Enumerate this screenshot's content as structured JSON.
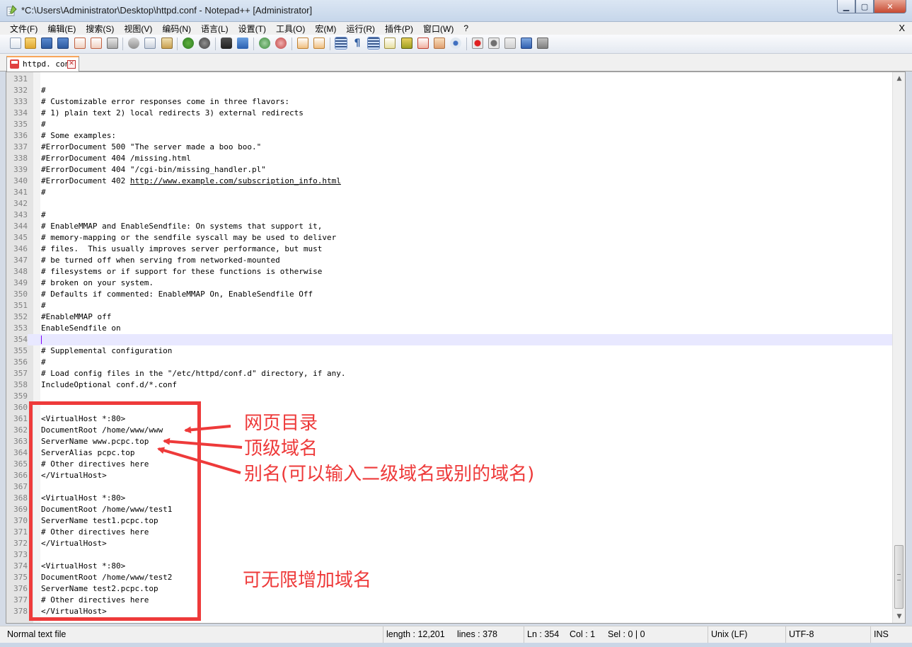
{
  "window": {
    "title": "*C:\\Users\\Administrator\\Desktop\\httpd.conf - Notepad++ [Administrator]",
    "minimize_label": "▁",
    "maximize_label": "▢",
    "close_label": "✕"
  },
  "menu": {
    "items": [
      "文件(F)",
      "编辑(E)",
      "搜索(S)",
      "视图(V)",
      "编码(N)",
      "语言(L)",
      "设置(T)",
      "工具(O)",
      "宏(M)",
      "运行(R)",
      "插件(P)",
      "窗口(W)",
      "?"
    ],
    "close_label": "X"
  },
  "toolbar": {
    "buttons": [
      "new-icon",
      "open-icon",
      "save-icon",
      "save-all-icon",
      "close-icon",
      "close-all-icon",
      "print-icon",
      "cut-icon",
      "copy-icon",
      "paste-icon",
      "undo-icon",
      "redo-icon",
      "find-icon",
      "replace-icon",
      "zoom-in-icon",
      "zoom-out-icon",
      "sync-vertical-icon",
      "sync-horizontal-icon",
      "word-wrap-icon",
      "show-all-chars-icon",
      "indent-guide-icon",
      "user-lang-icon",
      "doc-map-icon",
      "function-list-icon",
      "folder-workspace-icon",
      "monitor-icon",
      "record-macro-icon",
      "stop-macro-icon",
      "play-macro-icon",
      "run-macro-multiple-icon",
      "save-macro-icon"
    ]
  },
  "tab": {
    "label": "httpd. conf",
    "close_label": "✕"
  },
  "editor": {
    "current_line": 354,
    "lines": [
      {
        "n": "331",
        "t": ""
      },
      {
        "n": "332",
        "t": "#"
      },
      {
        "n": "333",
        "t": "# Customizable error responses come in three flavors:"
      },
      {
        "n": "334",
        "t": "# 1) plain text 2) local redirects 3) external redirects"
      },
      {
        "n": "335",
        "t": "#"
      },
      {
        "n": "336",
        "t": "# Some examples:"
      },
      {
        "n": "337",
        "t": "#ErrorDocument 500 \"The server made a boo boo.\""
      },
      {
        "n": "338",
        "t": "#ErrorDocument 404 /missing.html"
      },
      {
        "n": "339",
        "t": "#ErrorDocument 404 \"/cgi-bin/missing_handler.pl\""
      },
      {
        "n": "340",
        "t": "#ErrorDocument 402 ",
        "link": "http://www.example.com/subscription_info.html"
      },
      {
        "n": "341",
        "t": "#"
      },
      {
        "n": "342",
        "t": ""
      },
      {
        "n": "343",
        "t": "#"
      },
      {
        "n": "344",
        "t": "# EnableMMAP and EnableSendfile: On systems that support it,"
      },
      {
        "n": "345",
        "t": "# memory-mapping or the sendfile syscall may be used to deliver"
      },
      {
        "n": "346",
        "t": "# files.  This usually improves server performance, but must"
      },
      {
        "n": "347",
        "t": "# be turned off when serving from networked-mounted"
      },
      {
        "n": "348",
        "t": "# filesystems or if support for these functions is otherwise"
      },
      {
        "n": "349",
        "t": "# broken on your system."
      },
      {
        "n": "350",
        "t": "# Defaults if commented: EnableMMAP On, EnableSendfile Off"
      },
      {
        "n": "351",
        "t": "#"
      },
      {
        "n": "352",
        "t": "#EnableMMAP off"
      },
      {
        "n": "353",
        "t": "EnableSendfile on"
      },
      {
        "n": "354",
        "t": ""
      },
      {
        "n": "355",
        "t": "# Supplemental configuration"
      },
      {
        "n": "356",
        "t": "#"
      },
      {
        "n": "357",
        "t": "# Load config files in the \"/etc/httpd/conf.d\" directory, if any."
      },
      {
        "n": "358",
        "t": "IncludeOptional conf.d/*.conf"
      },
      {
        "n": "359",
        "t": ""
      },
      {
        "n": "360",
        "t": ""
      },
      {
        "n": "361",
        "t": "<VirtualHost *:80>"
      },
      {
        "n": "362",
        "t": "DocumentRoot /home/www/www"
      },
      {
        "n": "363",
        "t": "ServerName www.pcpc.top"
      },
      {
        "n": "364",
        "t": "ServerAlias pcpc.top"
      },
      {
        "n": "365",
        "t": "# Other directives here"
      },
      {
        "n": "366",
        "t": "</VirtualHost>"
      },
      {
        "n": "367",
        "t": ""
      },
      {
        "n": "368",
        "t": "<VirtualHost *:80>"
      },
      {
        "n": "369",
        "t": "DocumentRoot /home/www/test1"
      },
      {
        "n": "370",
        "t": "ServerName test1.pcpc.top"
      },
      {
        "n": "371",
        "t": "# Other directives here"
      },
      {
        "n": "372",
        "t": "</VirtualHost>"
      },
      {
        "n": "373",
        "t": ""
      },
      {
        "n": "374",
        "t": "<VirtualHost *:80>"
      },
      {
        "n": "375",
        "t": "DocumentRoot /home/www/test2"
      },
      {
        "n": "376",
        "t": "ServerName test2.pcpc.top"
      },
      {
        "n": "377",
        "t": "# Other directives here"
      },
      {
        "n": "378",
        "t": "</VirtualHost>"
      }
    ]
  },
  "annotations": {
    "doc_root": "网页目录",
    "top_domain": "顶级域名",
    "alias": "别名(可以输入二级域名或别的域名)",
    "unlimited": "可无限增加域名",
    "color": "#ee3a3a"
  },
  "statusbar": {
    "file_type": "Normal text file",
    "length": "length : 12,201",
    "lines": "lines : 378",
    "ln": "Ln : 354",
    "col": "Col : 1",
    "sel": "Sel : 0 | 0",
    "eol": "Unix (LF)",
    "encoding": "UTF-8",
    "mode": "INS"
  }
}
